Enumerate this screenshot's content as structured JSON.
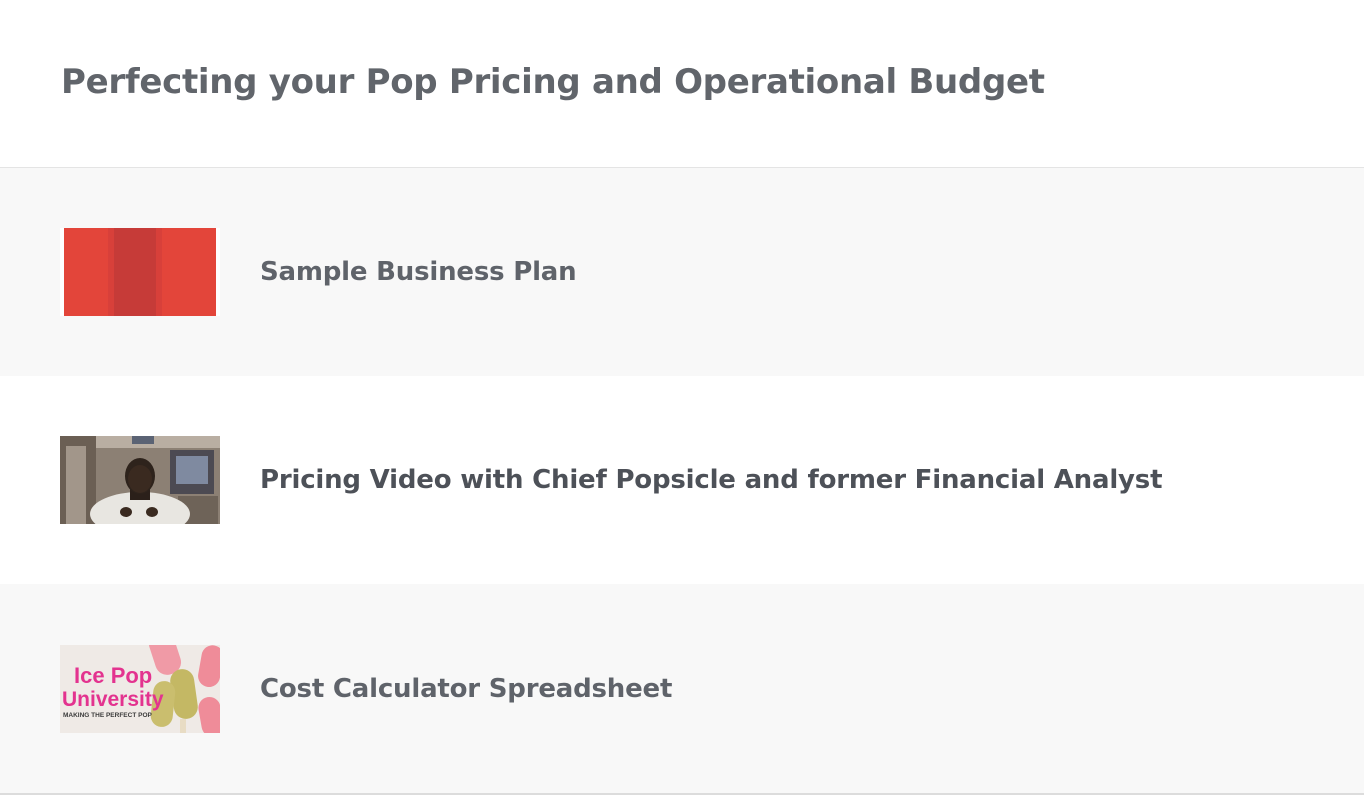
{
  "section": {
    "title": "Perfecting your Pop Pricing and Operational Budget"
  },
  "lessons": [
    {
      "title": "Sample Business Plan",
      "thumbnail": "red-document-thumbnail"
    },
    {
      "title": "Pricing Video with Chief Popsicle and former Financial Analyst",
      "thumbnail": "video-presenter-thumbnail"
    },
    {
      "title": "Cost Calculator Spreadsheet",
      "thumbnail": "ice-pop-university-thumbnail",
      "thumbnail_text": {
        "line1": "Ice Pop",
        "line2": "University",
        "tagline": "MAKING THE PERFECT POP"
      }
    }
  ],
  "colors": {
    "alt_row": "#f8f8f8",
    "title_text": "#61656b",
    "accent_red": "#e0443a",
    "brand_pink": "#e3338f"
  }
}
